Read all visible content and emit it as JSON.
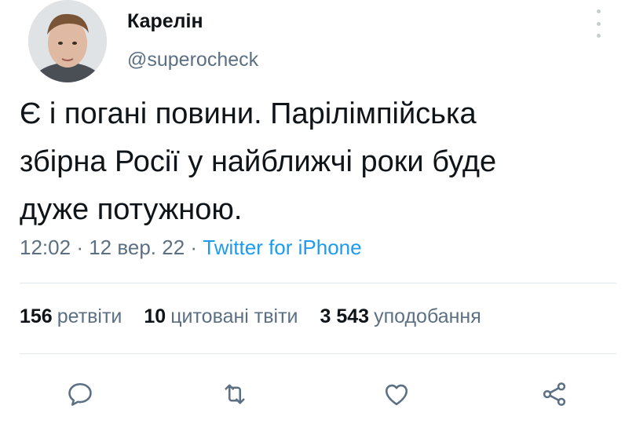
{
  "tweet": {
    "author": {
      "name": "Карелін",
      "handle": "@superocheck"
    },
    "text_lines": [
      "Є і погані повини. Парілімпійська",
      "збірна Росії у найближчі роки буде",
      "дуже потужною."
    ],
    "time": "12:02",
    "separator": "·",
    "date": "12 вер. 22",
    "source": "Twitter for iPhone",
    "stats": {
      "retweets": {
        "count": "156",
        "label": "ретвіти"
      },
      "quotes": {
        "count": "10",
        "label": "цитовані твіти"
      },
      "likes": {
        "count": "3 543",
        "label": "уподобання"
      }
    },
    "icons": {
      "reply": "reply-icon",
      "retweet": "retweet-icon",
      "like": "heart-icon",
      "share": "share-icon",
      "more": "more-icon"
    }
  },
  "colors": {
    "text": "#0f1419",
    "secondary": "#5b7083",
    "link": "#1d9bf0",
    "divider": "#e1e8ed",
    "icon": "#5b7083"
  }
}
